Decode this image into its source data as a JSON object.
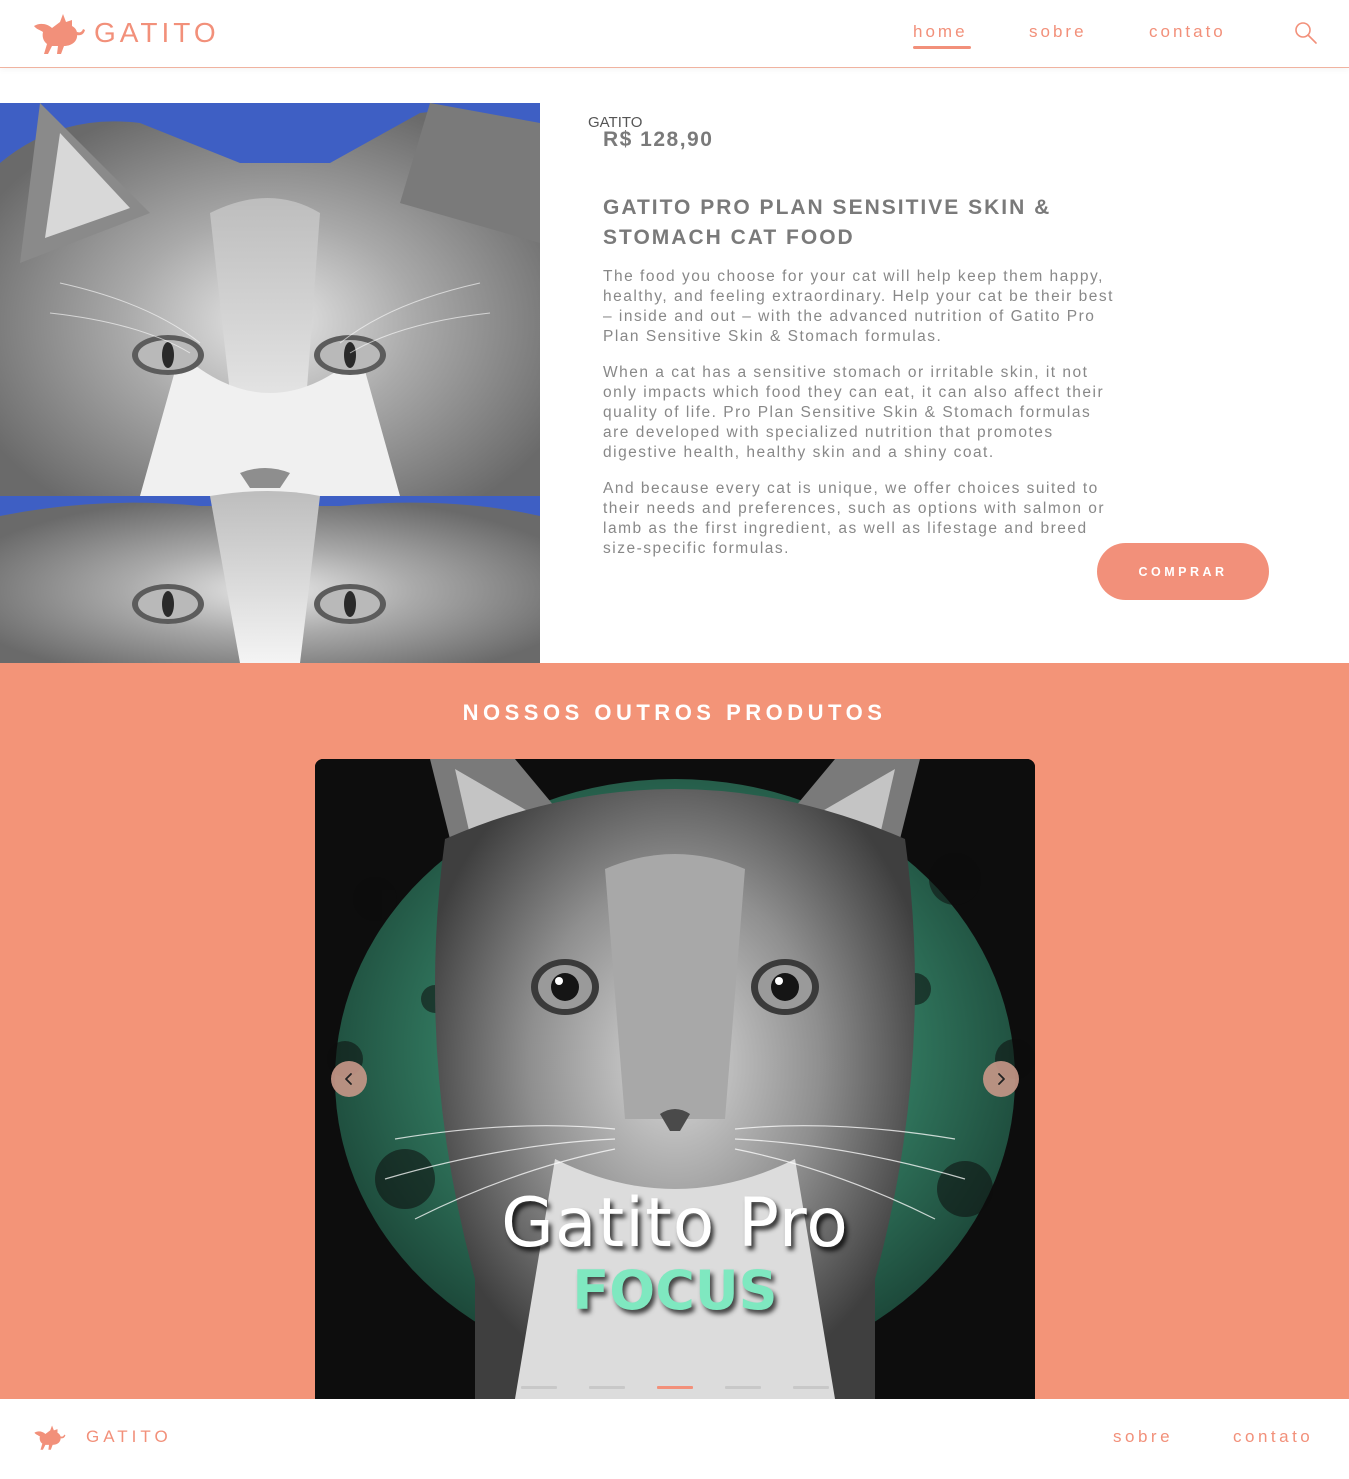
{
  "brand": {
    "name": "GATITO",
    "color": "#f2907a",
    "icon": "cat-logo-icon"
  },
  "nav": {
    "home": "home",
    "sobre": "sobre",
    "contato": "contato",
    "active": "home",
    "search_icon": "search-icon"
  },
  "product": {
    "brand": "GATITO",
    "price": "R$ 128,90",
    "title": "GATITO PRO PLAN SENSITIVE SKIN & STOMACH CAT FOOD",
    "paragraphs": [
      "The food you choose for your cat will help keep them happy, healthy, and feeling extraordinary. Help your cat be their best – inside and out – with the advanced nutrition of Gatito Pro Plan Sensitive Skin & Stomach formulas.",
      "When a cat has a sensitive stomach or irritable skin, it not only impacts which food they can eat, it can also affect their quality of life. Pro Plan Sensitive Skin & Stomach formulas are developed with specialized nutrition that promotes digestive health, healthy skin and a shiny coat.",
      "And because every cat is unique, we offer choices suited to their needs and preferences, such as options with salmon or lamb as the first ingredient, as well as lifestage and breed size-specific formulas."
    ],
    "buy_label": "COMPRAR"
  },
  "other_products": {
    "title": "NOSSOS OUTROS PRODUTOS",
    "background": "#f39478",
    "slide": {
      "caption_main": "Gatito Pro",
      "caption_sub": "FOCUS",
      "caption_sub_color": "#7fe8c0"
    },
    "slide_count": 5,
    "active_slide": 3,
    "prev_icon": "chevron-left-icon",
    "next_icon": "chevron-right-icon"
  },
  "footer": {
    "brand": "GATITO",
    "sobre": "sobre",
    "contato": "contato"
  }
}
